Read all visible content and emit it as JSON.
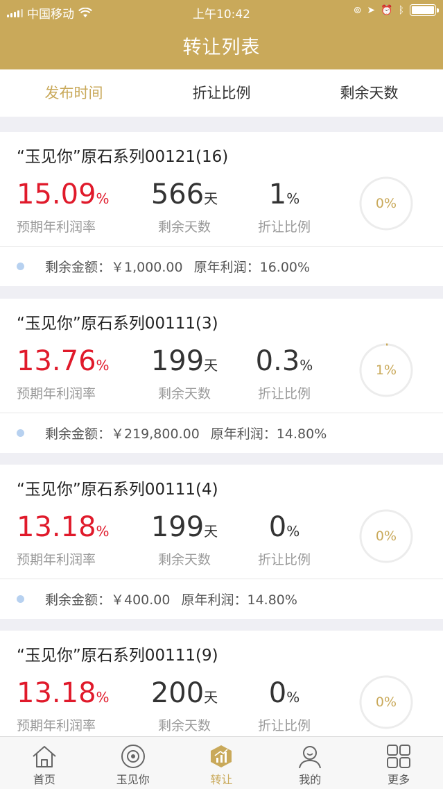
{
  "status_bar": {
    "carrier": "中国移动",
    "time": "上午10:42"
  },
  "header": {
    "title": "转让列表"
  },
  "sort_tabs": [
    {
      "label": "发布时间",
      "active": true
    },
    {
      "label": "折让比例",
      "active": false
    },
    {
      "label": "剩余天数",
      "active": false
    }
  ],
  "items": [
    {
      "title": "“玉见你”原石系列00121(16)",
      "rate": "15.09",
      "rate_unit": "%",
      "rate_label": "预期年利润率",
      "days": "566",
      "days_unit": "天",
      "days_label": "剩余天数",
      "discount": "1",
      "discount_unit": "%",
      "discount_label": "折让比例",
      "progress": 0,
      "progress_label": "0%",
      "remaining": "剩余金额：￥1,000.00",
      "orig_profit": "原年利润：16.00%"
    },
    {
      "title": "“玉见你”原石系列00111(3)",
      "rate": "13.76",
      "rate_unit": "%",
      "rate_label": "预期年利润率",
      "days": "199",
      "days_unit": "天",
      "days_label": "剩余天数",
      "discount": "0.3",
      "discount_unit": "%",
      "discount_label": "折让比例",
      "progress": 0.01,
      "progress_label": "1%",
      "remaining": "剩余金额：￥219,800.00",
      "orig_profit": "原年利润：14.80%"
    },
    {
      "title": "“玉见你”原石系列00111(4)",
      "rate": "13.18",
      "rate_unit": "%",
      "rate_label": "预期年利润率",
      "days": "199",
      "days_unit": "天",
      "days_label": "剩余天数",
      "discount": "0",
      "discount_unit": "%",
      "discount_label": "折让比例",
      "progress": 0,
      "progress_label": "0%",
      "remaining": "剩余金额：￥400.00",
      "orig_profit": "原年利润：14.80%"
    },
    {
      "title": "“玉见你”原石系列00111(9)",
      "rate": "13.18",
      "rate_unit": "%",
      "rate_label": "预期年利润率",
      "days": "200",
      "days_unit": "天",
      "days_label": "剩余天数",
      "discount": "0",
      "discount_unit": "%",
      "discount_label": "折让比例",
      "progress": 0,
      "progress_label": "0%",
      "remaining": "",
      "orig_profit": ""
    }
  ],
  "tab_bar": [
    {
      "label": "首页",
      "icon": "home-icon",
      "active": false
    },
    {
      "label": "玉见你",
      "icon": "disc-icon",
      "active": false
    },
    {
      "label": "转让",
      "icon": "transfer-chart-icon",
      "active": true
    },
    {
      "label": "我的",
      "icon": "person-icon",
      "active": false
    },
    {
      "label": "更多",
      "icon": "grid-icon",
      "active": false
    }
  ],
  "colors": {
    "brand": "#c9a95a",
    "rate_red": "#e01a2b"
  }
}
